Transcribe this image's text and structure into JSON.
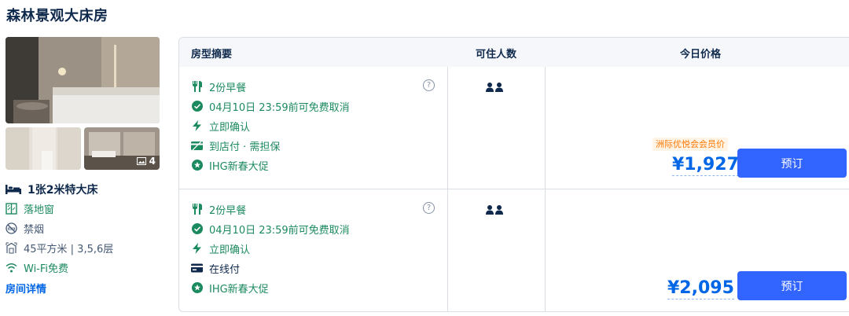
{
  "room": {
    "title": "森林景观大床房",
    "photo_count": "4",
    "bed": "1张2米特大床",
    "features": [
      {
        "icon": "window-icon",
        "text": "落地窗"
      },
      {
        "icon": "no-smoking-icon",
        "text": "禁烟"
      },
      {
        "icon": "area-icon",
        "text": "45平方米 | 3,5,6层"
      },
      {
        "icon": "wifi-icon",
        "text": "Wi-Fi免费"
      }
    ],
    "detail_link": "房间详情"
  },
  "table": {
    "headers": {
      "summary": "房型摘要",
      "guests": "可住人数",
      "price": "今日价格"
    },
    "rows": [
      {
        "policies": [
          {
            "icon": "dining-icon",
            "text": "2份早餐"
          },
          {
            "icon": "check-circle-icon",
            "text": "04月10日 23:59前可免费取消"
          },
          {
            "icon": "lightning-icon",
            "text": "立即确认"
          },
          {
            "icon": "pay-at-hotel-icon",
            "text": "到店付 · 需担保"
          },
          {
            "icon": "star-badge-icon",
            "text": "IHG新春大促"
          }
        ],
        "help": "?",
        "member_badge": "洲际优悦会会员价",
        "price": "¥1,927",
        "book": "预订"
      },
      {
        "policies": [
          {
            "icon": "dining-icon",
            "text": "2份早餐"
          },
          {
            "icon": "check-circle-icon",
            "text": "04月10日 23:59前可免费取消"
          },
          {
            "icon": "lightning-icon",
            "text": "立即确认"
          },
          {
            "icon": "card-icon",
            "text": "在线付"
          },
          {
            "icon": "star-badge-icon",
            "text": "IHG新春大促"
          }
        ],
        "help": "?",
        "price": "¥2,095",
        "book": "预订"
      }
    ]
  },
  "colors": {
    "accent": "#3264ff",
    "price": "#0066e6",
    "policy_green": "#1c8a5f",
    "member_orange": "#ff7700",
    "text": "#0f294d"
  }
}
